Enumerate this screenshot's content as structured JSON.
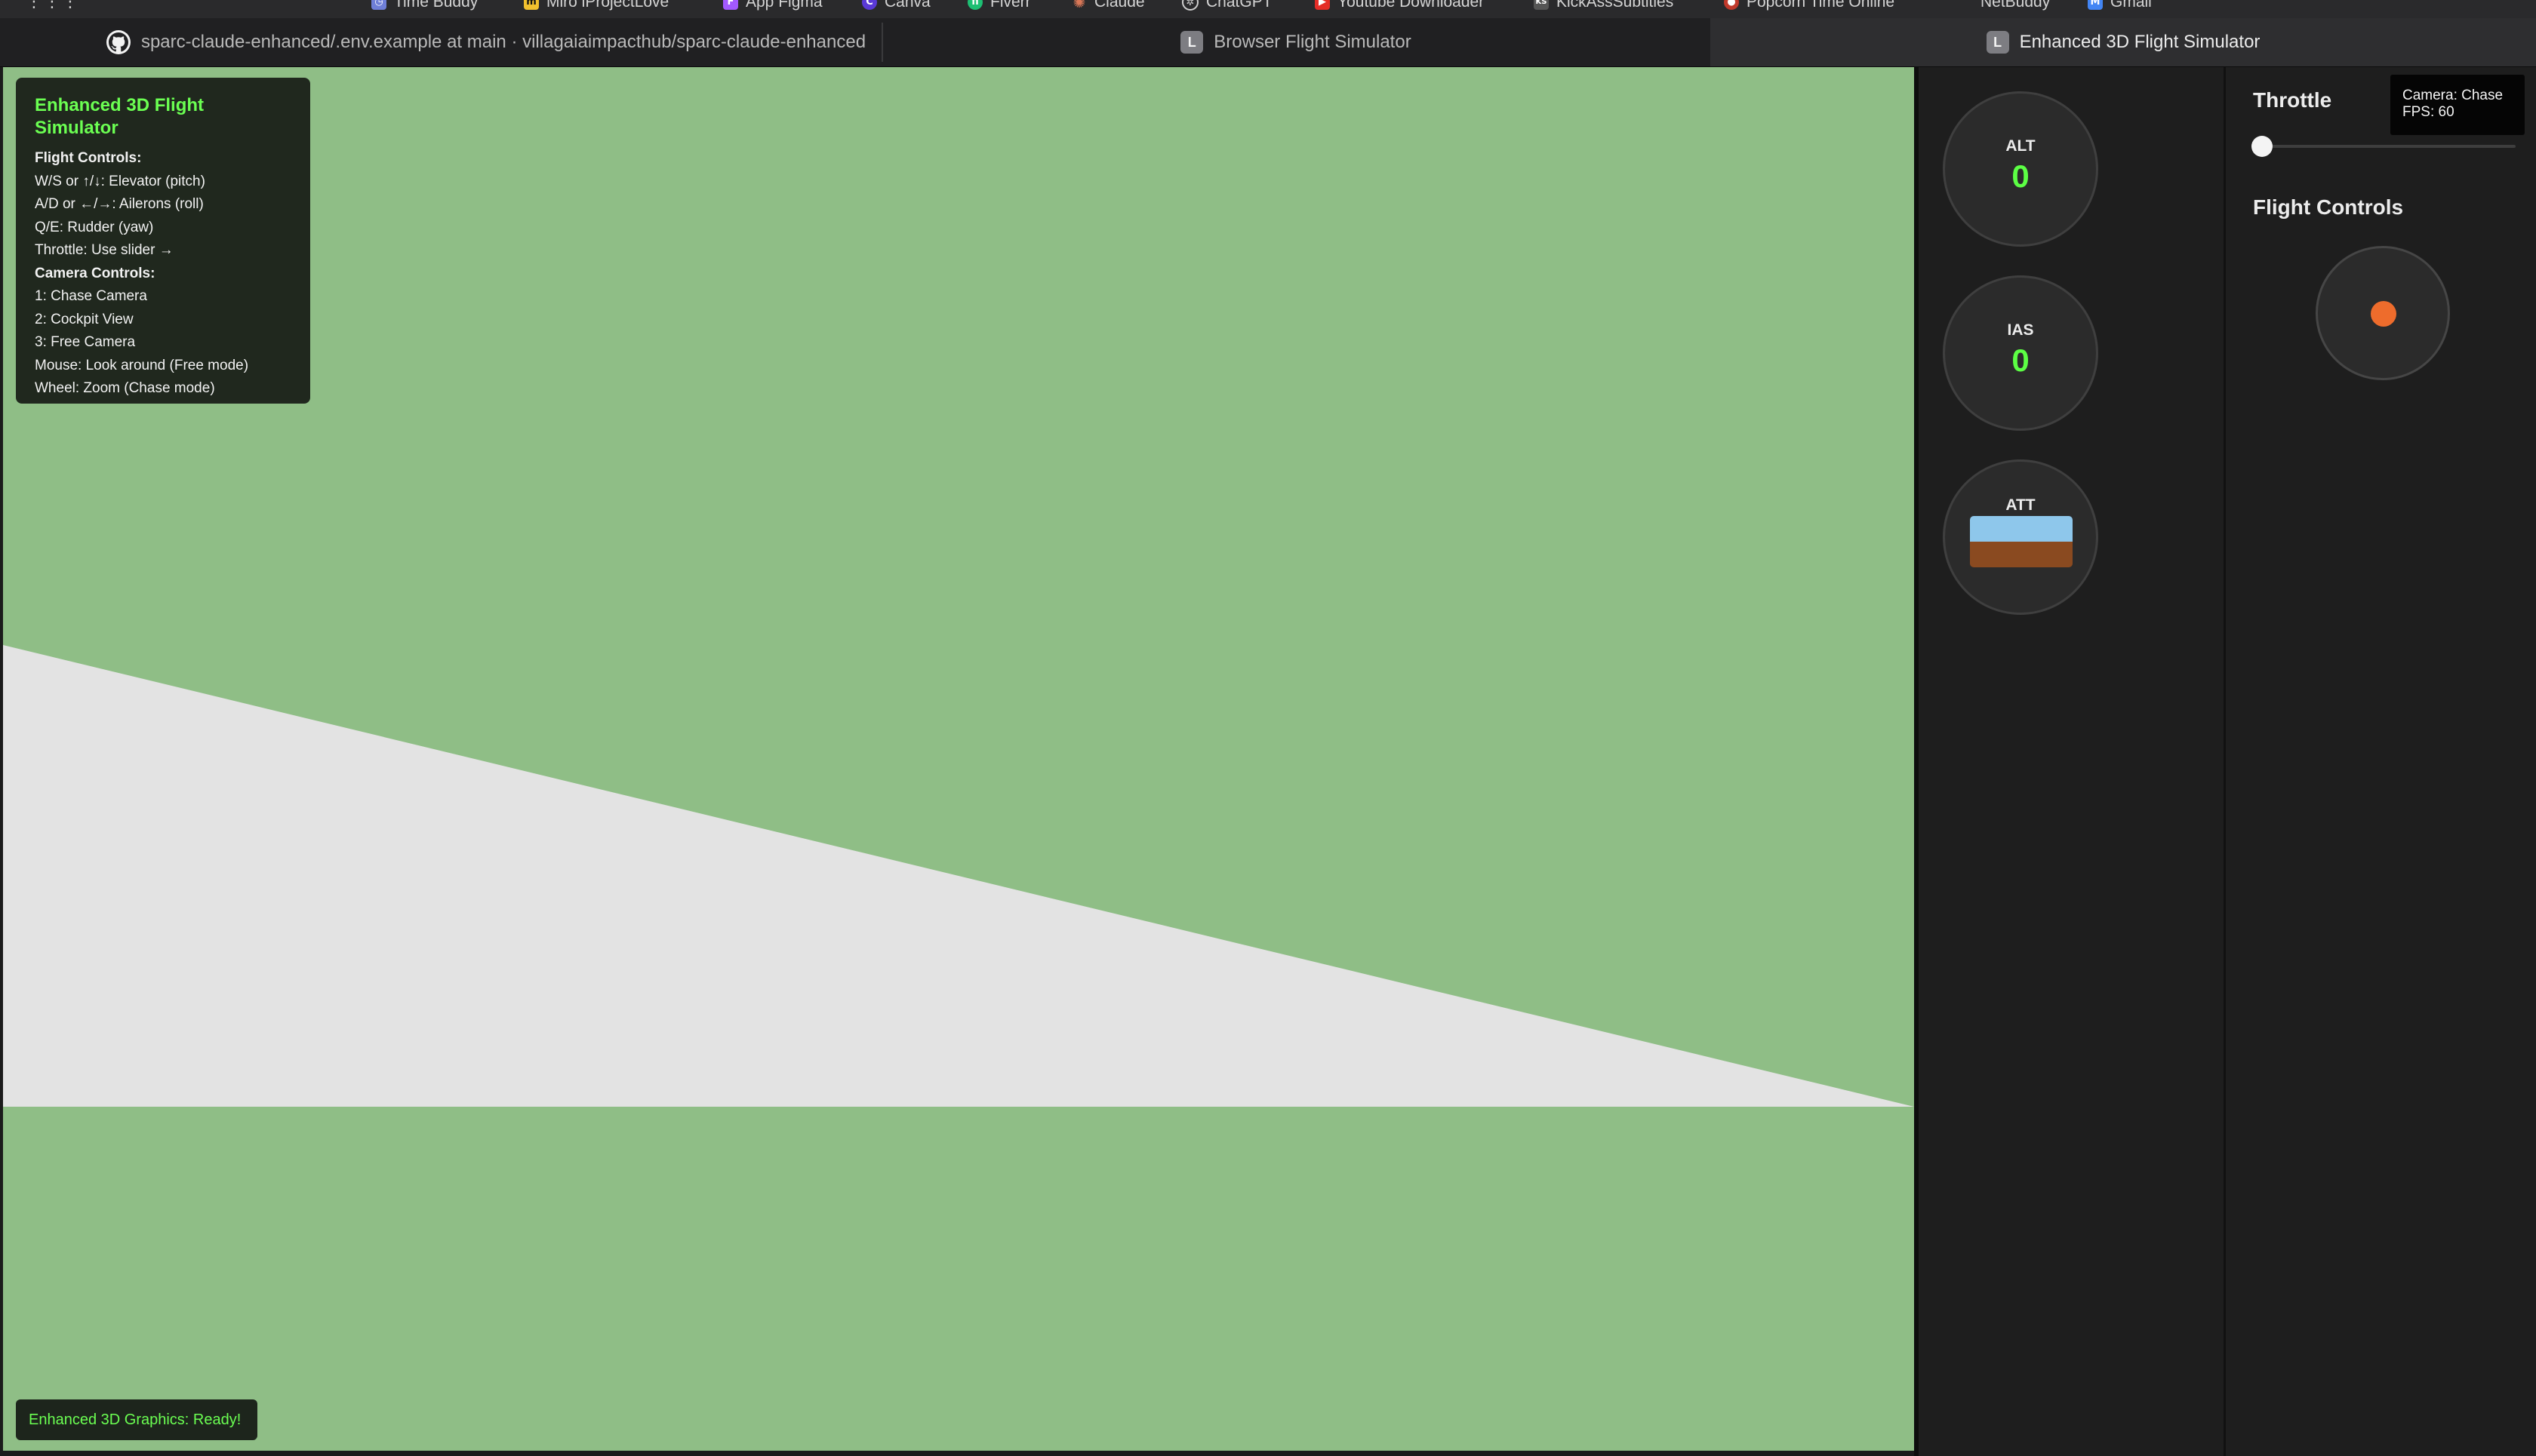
{
  "bookmarks": [
    {
      "label": "Time Buddy",
      "icon": "clock-icon",
      "color": "#6f7fd8"
    },
    {
      "label": "Miro iProjectLove",
      "icon": "miro-icon",
      "color": "#f2c12e"
    },
    {
      "label": "App Figma",
      "icon": "figma-icon",
      "color": "#a259ff"
    },
    {
      "label": "Canva",
      "icon": "canva-icon",
      "color": "#5a39d6"
    },
    {
      "label": "Fiverr",
      "icon": "fiverr-icon",
      "color": "#1dbf73"
    },
    {
      "label": "Claude",
      "icon": "claude-icon",
      "color": "#d97757"
    },
    {
      "label": "ChatGPT",
      "icon": "chatgpt-icon",
      "color": "#444444"
    },
    {
      "label": "Youtube Downloader",
      "icon": "youtube-icon",
      "color": "#e52d27"
    },
    {
      "label": "KickAssSubtitles",
      "icon": "subtitles-icon",
      "color": "#555555"
    },
    {
      "label": "Popcorn Time Online",
      "icon": "popcorn-icon",
      "color": "#c0392b"
    },
    {
      "label": "NetBuddy",
      "icon": "netbuddy-icon",
      "color": "#2a2a2c"
    },
    {
      "label": "Gmail",
      "icon": "gmail-icon",
      "color": "#4285f4"
    }
  ],
  "tabs": [
    {
      "title": "sparc-claude-enhanced/.env.example at main · villagaiaimpacthub/sparc-claude-enhanced",
      "icon": "github-icon",
      "active": false
    },
    {
      "title": "Browser Flight Simulator",
      "icon": "l-favicon-icon",
      "favicon_letter": "L",
      "active": false
    },
    {
      "title": "Enhanced 3D Flight Simulator",
      "icon": "l-favicon-icon",
      "favicon_letter": "L",
      "active": true
    }
  ],
  "help": {
    "title": "Enhanced 3D Flight Simulator",
    "flight_heading": "Flight Controls:",
    "flight_lines": [
      "W/S or ↑/↓: Elevator (pitch)",
      "A/D or ←/→: Ailerons (roll)",
      "Q/E: Rudder (yaw)",
      "Throttle: Use slider →"
    ],
    "camera_heading": "Camera Controls:",
    "camera_lines": [
      "1: Chase Camera",
      "2: Cockpit View",
      "3: Free Camera",
      "Mouse: Look around (Free mode)",
      "Wheel: Zoom (Chase mode)"
    ]
  },
  "status": "Enhanced 3D Graphics: Ready!",
  "instruments": {
    "alt": {
      "label": "ALT",
      "value": "0"
    },
    "ias": {
      "label": "IAS",
      "value": "0"
    },
    "att": {
      "label": "ATT",
      "sky_color": "#8ec7eb",
      "ground_color": "#8a4a20"
    }
  },
  "controls": {
    "throttle_label": "Throttle",
    "throttle_value": 0,
    "flight_controls_label": "Flight Controls"
  },
  "camera_info": {
    "camera": "Camera: Chase",
    "fps": "FPS: 60"
  },
  "colors": {
    "ground": "#8fbe86",
    "runway": "#e3e3e3",
    "accent_green": "#5cff44",
    "joystick_knob": "#ee6c2c"
  }
}
